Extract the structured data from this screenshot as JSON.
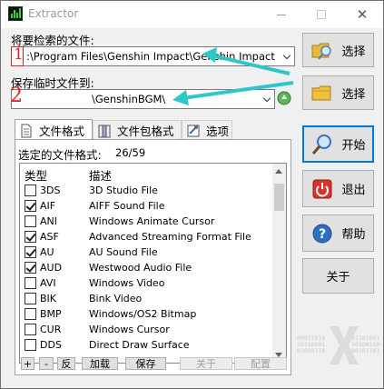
{
  "window": {
    "title": "Extractor"
  },
  "source": {
    "label": "将要检索的文件:",
    "value": ":\\Program Files\\Genshin Impact\\Genshin Impact Game\\Y"
  },
  "dest": {
    "label": "保存临时文件到:",
    "value": "\\GenshinBGM\\"
  },
  "annotations": {
    "marker1": "1",
    "marker2": "2",
    "arrow_color": "#2fc6c8",
    "marker_color": "#e02020"
  },
  "tabs": [
    {
      "label": "文件格式",
      "icon": "document-icon"
    },
    {
      "label": "文件包格式",
      "icon": "archive-icon"
    },
    {
      "label": "选项",
      "icon": "options-icon"
    }
  ],
  "formats": {
    "label": "选定的文件格式:",
    "count": "26/59",
    "columns": [
      "类型",
      "描述"
    ],
    "rows": [
      {
        "ext": "3DS",
        "desc": "3D Studio File",
        "checked": false
      },
      {
        "ext": "AIF",
        "desc": "AIFF Sound File",
        "checked": true
      },
      {
        "ext": "ANI",
        "desc": "Windows Animate Cursor",
        "checked": false
      },
      {
        "ext": "ASF",
        "desc": "Advanced Streaming Format File",
        "checked": true
      },
      {
        "ext": "AU",
        "desc": "AU Sound File",
        "checked": true
      },
      {
        "ext": "AUD",
        "desc": "Westwood Audio File",
        "checked": true
      },
      {
        "ext": "AVI",
        "desc": "Windows Video",
        "checked": false
      },
      {
        "ext": "BIK",
        "desc": "Bink Video",
        "checked": false
      },
      {
        "ext": "BMP",
        "desc": "Windows/OS2 Bitmap",
        "checked": false
      },
      {
        "ext": "CUR",
        "desc": "Windows Cursor",
        "checked": false
      },
      {
        "ext": "DDS",
        "desc": "Direct Draw Surface",
        "checked": false
      }
    ]
  },
  "bottom_buttons": {
    "plus": "+",
    "minus": "-",
    "invert": "反",
    "load": "加载",
    "save": "保存",
    "about": "关于",
    "config": "配置"
  },
  "side_buttons": {
    "browse1": "选择",
    "browse2": "选择",
    "start": "开始",
    "exit": "退出",
    "help": "帮助",
    "about": "关于"
  },
  "watermark": {
    "bits_left": "00011010\n10110001\n01000110",
    "bits_right": "01101001\n10100110\n00101101"
  }
}
